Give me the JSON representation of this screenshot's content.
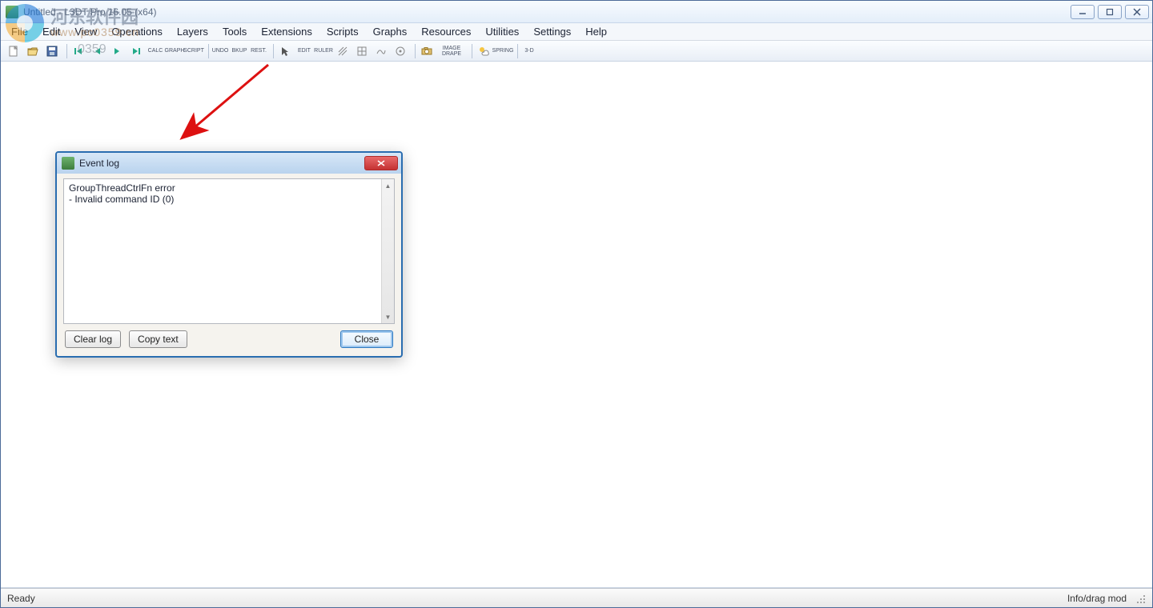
{
  "window": {
    "title": "Untitled - L3DT Pro 16.05 (x64)"
  },
  "menus": [
    "File",
    "Edit",
    "View",
    "Operations",
    "Layers",
    "Tools",
    "Extensions",
    "Scripts",
    "Graphs",
    "Resources",
    "Utilities",
    "Settings",
    "Help"
  ],
  "toolbar": {
    "groups": [
      [
        {
          "name": "new-icon",
          "label": ""
        },
        {
          "name": "open-icon",
          "label": ""
        },
        {
          "name": "save-icon",
          "label": ""
        }
      ],
      [
        {
          "name": "nav-first-icon",
          "label": ""
        },
        {
          "name": "nav-prev-icon",
          "label": ""
        },
        {
          "name": "nav-next-icon",
          "label": ""
        },
        {
          "name": "nav-last-icon",
          "label": ""
        },
        {
          "name": "calc-text",
          "label": "CALC"
        },
        {
          "name": "graph-text",
          "label": "GRAPH"
        },
        {
          "name": "script-text",
          "label": "SCRIPT"
        }
      ],
      [
        {
          "name": "undo-text",
          "label": "UNDO"
        },
        {
          "name": "bkup-text",
          "label": "BKUP"
        },
        {
          "name": "rest-text",
          "label": "REST."
        }
      ],
      [
        {
          "name": "pointer-icon",
          "label": ""
        },
        {
          "name": "edit-text",
          "label": "EDIT"
        },
        {
          "name": "ruler-text",
          "label": "RULER"
        },
        {
          "name": "tool1-icon",
          "label": ""
        },
        {
          "name": "tool2-icon",
          "label": ""
        },
        {
          "name": "tool3-icon",
          "label": ""
        },
        {
          "name": "tool4-icon",
          "label": ""
        }
      ],
      [
        {
          "name": "camera-icon",
          "label": ""
        },
        {
          "name": "image-drape-text",
          "label": "IMAGE DRAPE"
        }
      ],
      [
        {
          "name": "climate-icon",
          "label": ""
        },
        {
          "name": "spring-text",
          "label": "SPRING"
        }
      ],
      [
        {
          "name": "threed-text",
          "label": "3-D"
        }
      ]
    ]
  },
  "dialog": {
    "title": "Event log",
    "lines": [
      "GroupThreadCtrlFn error",
      " - Invalid command ID (0)"
    ],
    "clear_label": "Clear log",
    "copy_label": "Copy text",
    "close_label": "Close"
  },
  "status": {
    "left": "Ready",
    "right": "Info/drag mod"
  },
  "watermark": {
    "cn": "河东软件园",
    "url": "www.pc0359.cn",
    "tel": "0359"
  }
}
